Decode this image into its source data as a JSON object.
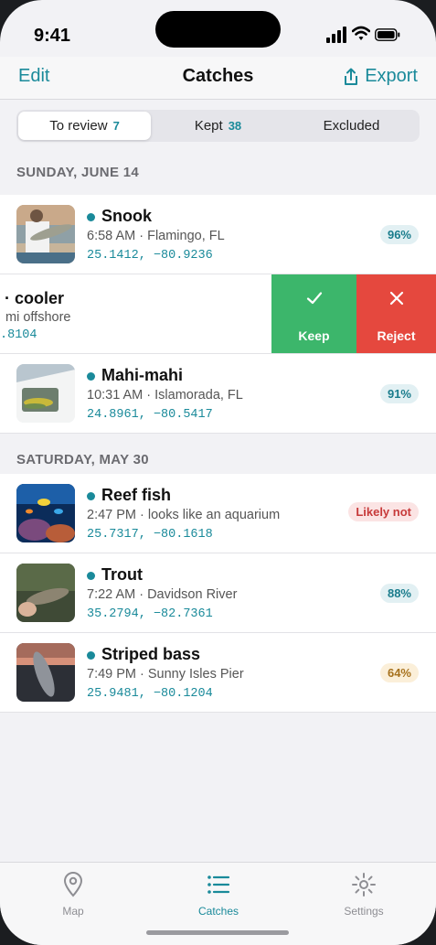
{
  "status": {
    "time": "9:41"
  },
  "nav": {
    "edit": "Edit",
    "title": "Catches",
    "export": "Export"
  },
  "segments": [
    {
      "label": "To review",
      "count": "7"
    },
    {
      "label": "Kept",
      "count": "38"
    },
    {
      "label": "Excluded",
      "count": ""
    }
  ],
  "sections": [
    {
      "header": "SUNDAY, JUNE 14"
    },
    {
      "header": "SATURDAY, MAY 30"
    }
  ],
  "catches": [
    {
      "name": "Snook",
      "meta": "6:58 AM · Flamingo, FL",
      "coords": "25.1412, −80.9236",
      "badge": "96%"
    },
    {
      "name": "· cooler",
      "meta": "mi offshore",
      "coords": ".8104",
      "badge": ""
    },
    {
      "name": "Mahi-mahi",
      "meta": "10:31 AM · Islamorada, FL",
      "coords": "24.8961, −80.5417",
      "badge": "91%"
    },
    {
      "name": "Reef fish",
      "meta": "2:47 PM · looks like an aquarium",
      "coords": "25.7317, −80.1618",
      "badge": "Likely not"
    },
    {
      "name": "Trout",
      "meta": "7:22 AM · Davidson River",
      "coords": "35.2794, −82.7361",
      "badge": "88%"
    },
    {
      "name": "Striped bass",
      "meta": "7:49 PM · Sunny Isles Pier",
      "coords": "25.9481, −80.1204",
      "badge": "64%"
    }
  ],
  "swipe_actions": {
    "keep": "Keep",
    "reject": "Reject"
  },
  "tabs": [
    {
      "label": "Map",
      "icon": "map-pin-icon"
    },
    {
      "label": "Catches",
      "icon": "list-icon"
    },
    {
      "label": "Settings",
      "icon": "gear-icon"
    }
  ],
  "colors": {
    "accent": "#1a8a9a",
    "keep": "#3cb66b",
    "reject": "#e5483e"
  }
}
